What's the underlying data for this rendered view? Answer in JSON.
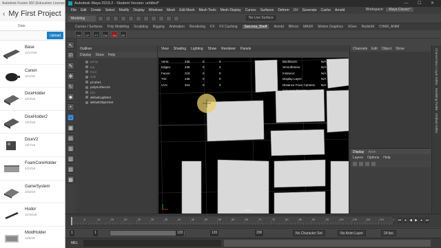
{
  "fusion": {
    "app_title": "Autodesk Fusion 360 (Education License)",
    "project_name": "My First Project",
    "date_column": "Date",
    "upload_label": "Upload",
    "items": [
      {
        "name": "Base",
        "date": "11/17/18"
      },
      {
        "name": "Canon",
        "date": "11/1/18"
      },
      {
        "name": "DiceHolder",
        "date": "12/3/18"
      },
      {
        "name": "DiceHolder2",
        "date": "12/3/18"
      },
      {
        "name": "DiceV2",
        "date": "12/7/18"
      },
      {
        "name": "FoamCoreHolder",
        "date": "4/23/19"
      },
      {
        "name": "GameSystem",
        "date": "3/28/19"
      },
      {
        "name": "Hodor",
        "date": "11/16/18"
      },
      {
        "name": "MoldHolder",
        "date": "11/5/18"
      }
    ]
  },
  "maya": {
    "window_title": "Autodesk Maya 2019.2 - Student Version: untitled*",
    "window_buttons": "— ☐ ✕",
    "menu": [
      "File",
      "Edit",
      "Create",
      "Select",
      "Modify",
      "Display",
      "Windows",
      "Mesh",
      "Edit Mesh",
      "Mesh Tools",
      "Mesh Display",
      "Curves",
      "Surfaces",
      "Deform",
      "UV",
      "Generate",
      "Cache",
      "Arnold"
    ],
    "workspace_label": "Workspace:",
    "workspace_value": "Maya Classic*",
    "mode": "Modeling",
    "live_surface": "No Live Surface",
    "shelf_tabs": [
      "Curves / Surfaces",
      "Poly Modeling",
      "Sculpting",
      "Rigging",
      "Animation",
      "Rendering",
      "FX",
      "FX Caching",
      "Sarcona_Shelf",
      "Arnold",
      "Bifrost",
      "MASH",
      "Motion Graphics",
      "XGen",
      "Redshift",
      "CHAR_ANIM"
    ],
    "active_shelf_tab": "Sarcona_Shelf",
    "shelf_icons": [
      "Sel",
      "CP",
      "FT",
      "Del",
      "Hd",
      "DE"
    ],
    "outliner": {
      "title": "Outliner",
      "menu": [
        "Display",
        "Show",
        "Help"
      ],
      "items": [
        {
          "label": "persp",
          "dim": true
        },
        {
          "label": "top",
          "dim": true
        },
        {
          "label": "front",
          "dim": true
        },
        {
          "label": "side",
          "dim": true
        },
        {
          "label": "pCube1",
          "dim": false
        },
        {
          "label": "polySurface15",
          "dim": false
        },
        {
          "label": "fdrs",
          "dim": true
        },
        {
          "label": "defaultLightSet",
          "dim": false
        },
        {
          "label": "defaultObjectSet",
          "dim": false
        }
      ]
    },
    "viewport": {
      "menu": [
        "View",
        "Shading",
        "Lighting",
        "Show",
        "Renderer",
        "Panels"
      ],
      "hud_left": [
        {
          "label": "Verts:",
          "v1": "236",
          "v2": "0",
          "v3": "0"
        },
        {
          "label": "Edges:",
          "v1": "436",
          "v2": "0",
          "v3": "0"
        },
        {
          "label": "Faces:",
          "v1": "218",
          "v2": "0",
          "v3": "0"
        },
        {
          "label": "Tris:",
          "v1": "436",
          "v2": "0",
          "v3": "0"
        },
        {
          "label": "UVs:",
          "v1": "344",
          "v2": "0",
          "v3": "0"
        }
      ],
      "hud_right": [
        {
          "label": "Backfaces:",
          "value": "N/A"
        },
        {
          "label": "Smoothness:",
          "value": "N/A"
        },
        {
          "label": "Instance:",
          "value": "N/A"
        },
        {
          "label": "Display Layer:",
          "value": "N/A"
        },
        {
          "label": "Distance From Camera:",
          "value": "N/A"
        },
        {
          "label": "Selected Objects:",
          "value": "0"
        }
      ],
      "camera_label": "persp"
    },
    "channel_box": {
      "menu": [
        "Channels",
        "Edit",
        "Object",
        "Show"
      ],
      "layer_tabs": [
        "Display",
        "Anim"
      ],
      "layer_menu": [
        "Layers",
        "Options",
        "Help"
      ]
    },
    "side_tabs": [
      "Channel Box / Layer Editor",
      "Modeling Toolkit",
      "Attribute Editor"
    ],
    "timeline": {
      "ticks": [
        "5",
        "10",
        "15",
        "20",
        "25",
        "30",
        "35",
        "40",
        "45",
        "50",
        "55",
        "60",
        "65",
        "70",
        "75",
        "80",
        "85",
        "90",
        "95",
        "100",
        "105",
        "110",
        "115",
        "120"
      ],
      "current_frame": "1"
    },
    "range": {
      "start": "1",
      "start_inner": "1",
      "range_end": "120",
      "end": "120",
      "end_outer": "200",
      "character_set": "No Character Set",
      "anim_layer": "No Anim Layer",
      "fps": "24 fps"
    },
    "command": {
      "label": "MEL"
    }
  }
}
